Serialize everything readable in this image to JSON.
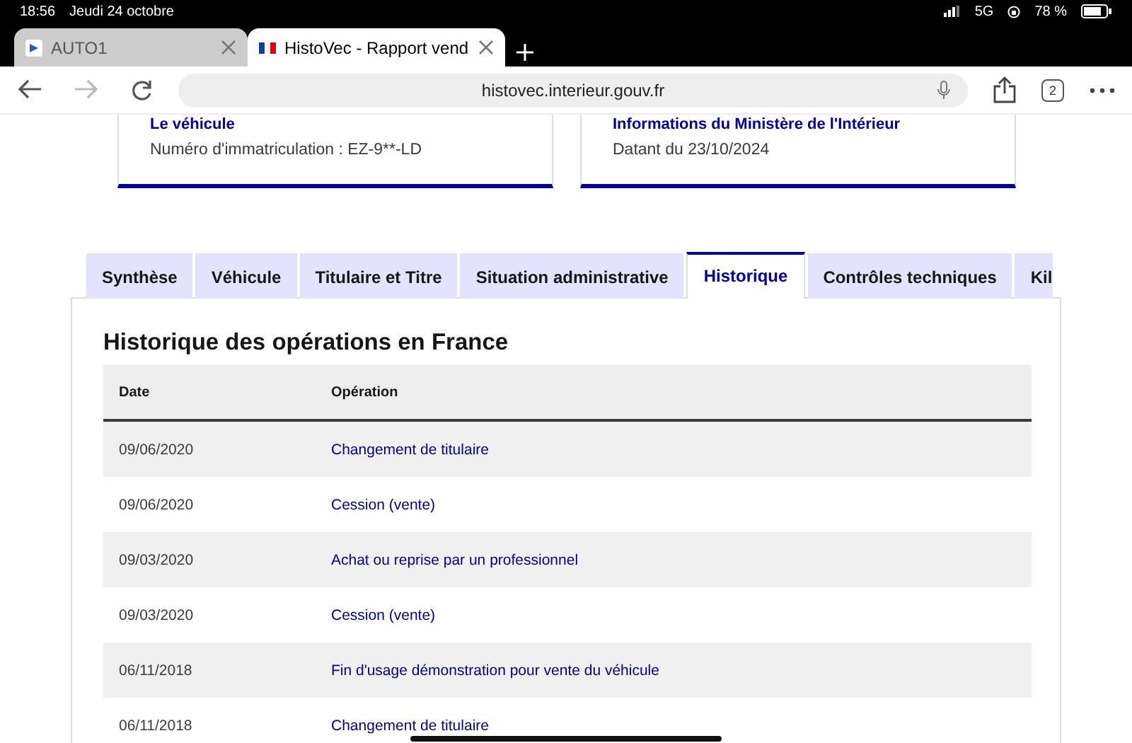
{
  "status_bar": {
    "time": "18:56",
    "date": "Jeudi 24 octobre",
    "network": "5G",
    "battery": "78 %"
  },
  "browser_tabs": [
    {
      "title": "AUTO1",
      "selected": false
    },
    {
      "title": "HistoVec - Rapport vend",
      "selected": true
    }
  ],
  "address_bar": {
    "url": "histovec.interieur.gouv.fr"
  },
  "tab_count": "2",
  "cards": [
    {
      "title": "Le véhicule",
      "text": "Numéro d'immatriculation : EZ-9**-LD"
    },
    {
      "title": "Informations du Ministère de l'Intérieur",
      "text": "Datant du 23/10/2024"
    }
  ],
  "tabs": [
    {
      "label": "Synthèse",
      "selected": false
    },
    {
      "label": "Véhicule",
      "selected": false
    },
    {
      "label": "Titulaire et Titre",
      "selected": false
    },
    {
      "label": "Situation administrative",
      "selected": false
    },
    {
      "label": "Historique",
      "selected": true
    },
    {
      "label": "Contrôles techniques",
      "selected": false
    },
    {
      "label": "Kil",
      "selected": false
    }
  ],
  "section_title": "Historique des opérations en France",
  "table": {
    "columns": [
      "Date",
      "Opération"
    ],
    "rows": [
      [
        "09/06/2020",
        "Changement de titulaire"
      ],
      [
        "09/06/2020",
        "Cession (vente)"
      ],
      [
        "09/03/2020",
        "Achat ou reprise par un professionnel"
      ],
      [
        "09/03/2020",
        "Cession (vente)"
      ],
      [
        "06/11/2018",
        "Fin d'usage démonstration pour vente du véhicule"
      ],
      [
        "06/11/2018",
        "Changement de titulaire"
      ]
    ]
  }
}
